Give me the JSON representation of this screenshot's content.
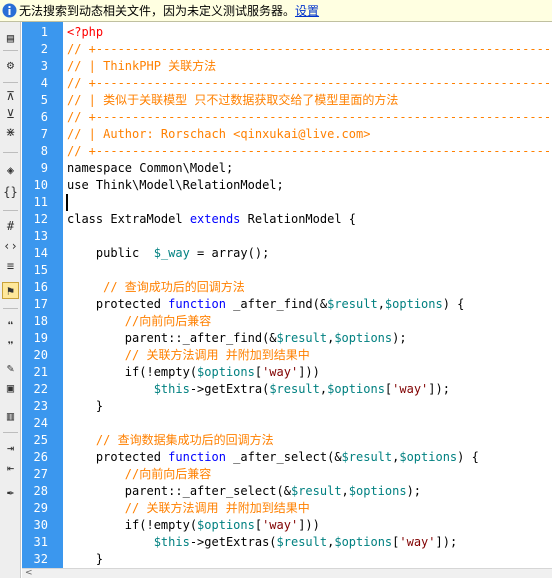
{
  "infobar": {
    "message": "无法搜索到动态相关文件，因为未定义测试服务器。",
    "link": "设置"
  },
  "toolbar": {
    "buttons": [
      {
        "name": "open-documents-icon",
        "glyph": "▤"
      },
      {
        "name": "settings-gear-icon",
        "glyph": "⚙"
      },
      {
        "name": "collapse-tag-icon",
        "glyph": "⊼"
      },
      {
        "name": "collapse-selection-icon",
        "glyph": "⊻"
      },
      {
        "name": "expand-all-icon",
        "glyph": "⋇"
      },
      {
        "name": "select-parent-tag-icon",
        "glyph": "◈"
      },
      {
        "name": "balance-braces-icon",
        "glyph": "{}"
      },
      {
        "name": "line-numbers-icon",
        "glyph": "#"
      },
      {
        "name": "highlight-invalid-code-icon",
        "glyph": "‹›"
      },
      {
        "name": "word-wrap-icon",
        "glyph": "≡"
      },
      {
        "name": "syntax-error-alerts-icon",
        "glyph": "⚑"
      },
      {
        "name": "apply-comment-icon",
        "glyph": "❝"
      },
      {
        "name": "remove-comment-icon",
        "glyph": "❞"
      },
      {
        "name": "wrap-tag-icon",
        "glyph": "✎"
      },
      {
        "name": "recent-snippets-icon",
        "glyph": "▣"
      },
      {
        "name": "move-css-icon",
        "glyph": "▥"
      },
      {
        "name": "indent-code-icon",
        "glyph": "⇥"
      },
      {
        "name": "outdent-code-icon",
        "glyph": "⇤"
      },
      {
        "name": "format-source-icon",
        "glyph": "✒"
      }
    ]
  },
  "code": {
    "line_numbers": [
      "1",
      "2",
      "3",
      "4",
      "5",
      "6",
      "7",
      "8",
      "9",
      "10",
      "11",
      "12",
      "13",
      "14",
      "15",
      "16",
      "17",
      "18",
      "19",
      "20",
      "21",
      "22",
      "23",
      "24",
      "25",
      "26",
      "27",
      "28",
      "29",
      "30",
      "31",
      "32"
    ],
    "lines": [
      [
        {
          "c": "tag",
          "t": "<?php"
        }
      ],
      [
        {
          "c": "cmt",
          "t": "// +----------------------------------------------------------------------"
        }
      ],
      [
        {
          "c": "cmt",
          "t": "// | ThinkPHP 关联方法"
        }
      ],
      [
        {
          "c": "cmt",
          "t": "// +----------------------------------------------------------------------"
        }
      ],
      [
        {
          "c": "cmt",
          "t": "// | 类似于关联模型 只不过数据获取交给了模型里面的方法"
        }
      ],
      [
        {
          "c": "cmt",
          "t": "// +----------------------------------------------------------------------"
        }
      ],
      [
        {
          "c": "cmt",
          "t": "// | Author: Rorschach <qinxukai@live.com>"
        }
      ],
      [
        {
          "c": "cmt",
          "t": "// +----------------------------------------------------------------------"
        }
      ],
      [
        {
          "c": "id",
          "t": "namespace Common\\Model;"
        }
      ],
      [
        {
          "c": "id",
          "t": "use Think\\Model\\RelationModel;"
        }
      ],
      [],
      [
        {
          "c": "id",
          "t": "class ExtraModel "
        },
        {
          "c": "kw",
          "t": "extends"
        },
        {
          "c": "id",
          "t": " RelationModel {"
        }
      ],
      [],
      [
        {
          "c": "id",
          "t": "    public  "
        },
        {
          "c": "var",
          "t": "$_way"
        },
        {
          "c": "id",
          "t": " = array();"
        }
      ],
      [],
      [
        {
          "c": "cmt",
          "t": "     // 查询成功后的回调方法"
        }
      ],
      [
        {
          "c": "id",
          "t": "    protected "
        },
        {
          "c": "kw",
          "t": "function"
        },
        {
          "c": "id",
          "t": " _after_find(&"
        },
        {
          "c": "var",
          "t": "$result"
        },
        {
          "c": "id",
          "t": ","
        },
        {
          "c": "var",
          "t": "$options"
        },
        {
          "c": "id",
          "t": ") {"
        }
      ],
      [
        {
          "c": "cmt",
          "t": "        //向前向后兼容"
        }
      ],
      [
        {
          "c": "id",
          "t": "        parent::_after_find(&"
        },
        {
          "c": "var",
          "t": "$result"
        },
        {
          "c": "id",
          "t": ","
        },
        {
          "c": "var",
          "t": "$options"
        },
        {
          "c": "id",
          "t": ");"
        }
      ],
      [
        {
          "c": "cmt",
          "t": "        // 关联方法调用 并附加到结果中"
        }
      ],
      [
        {
          "c": "id",
          "t": "        if(!empty("
        },
        {
          "c": "var",
          "t": "$options"
        },
        {
          "c": "id",
          "t": "["
        },
        {
          "c": "str",
          "t": "'way'"
        },
        {
          "c": "id",
          "t": "]))"
        }
      ],
      [
        {
          "c": "id",
          "t": "            "
        },
        {
          "c": "var",
          "t": "$this"
        },
        {
          "c": "id",
          "t": "->getExtra("
        },
        {
          "c": "var",
          "t": "$result"
        },
        {
          "c": "id",
          "t": ","
        },
        {
          "c": "var",
          "t": "$options"
        },
        {
          "c": "id",
          "t": "["
        },
        {
          "c": "str",
          "t": "'way'"
        },
        {
          "c": "id",
          "t": "]);"
        }
      ],
      [
        {
          "c": "id",
          "t": "    }"
        }
      ],
      [],
      [
        {
          "c": "cmt",
          "t": "    // 查询数据集成功后的回调方法"
        }
      ],
      [
        {
          "c": "id",
          "t": "    protected "
        },
        {
          "c": "kw",
          "t": "function"
        },
        {
          "c": "id",
          "t": " _after_select(&"
        },
        {
          "c": "var",
          "t": "$result"
        },
        {
          "c": "id",
          "t": ","
        },
        {
          "c": "var",
          "t": "$options"
        },
        {
          "c": "id",
          "t": ") {"
        }
      ],
      [
        {
          "c": "cmt",
          "t": "        //向前向后兼容"
        }
      ],
      [
        {
          "c": "id",
          "t": "        parent::_after_select(&"
        },
        {
          "c": "var",
          "t": "$result"
        },
        {
          "c": "id",
          "t": ","
        },
        {
          "c": "var",
          "t": "$options"
        },
        {
          "c": "id",
          "t": ");"
        }
      ],
      [
        {
          "c": "cmt",
          "t": "        // 关联方法调用 并附加到结果中"
        }
      ],
      [
        {
          "c": "id",
          "t": "        if(!empty("
        },
        {
          "c": "var",
          "t": "$options"
        },
        {
          "c": "id",
          "t": "["
        },
        {
          "c": "str",
          "t": "'way'"
        },
        {
          "c": "id",
          "t": "]))"
        }
      ],
      [
        {
          "c": "id",
          "t": "            "
        },
        {
          "c": "var",
          "t": "$this"
        },
        {
          "c": "id",
          "t": "->getExtras("
        },
        {
          "c": "var",
          "t": "$result"
        },
        {
          "c": "id",
          "t": ","
        },
        {
          "c": "var",
          "t": "$options"
        },
        {
          "c": "id",
          "t": "["
        },
        {
          "c": "str",
          "t": "'way'"
        },
        {
          "c": "id",
          "t": "]);"
        }
      ],
      [
        {
          "c": "id",
          "t": "    }"
        }
      ]
    ]
  },
  "colors": {
    "gutter": "#3b97ee",
    "comment": "#ff8000",
    "keyword": "#0000ff",
    "variable": "#008080",
    "string": "#800000",
    "php_tag": "#ff0000",
    "infobar": "#ffffe1"
  }
}
